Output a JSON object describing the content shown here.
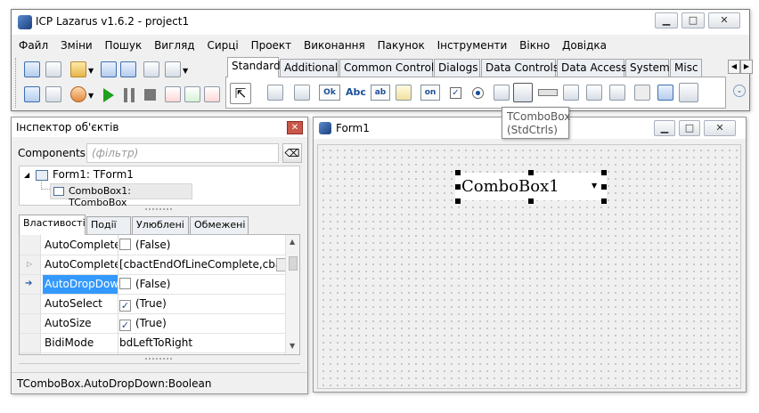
{
  "main": {
    "title": "ICP Lazarus v1.6.2 - project1",
    "menu": [
      "Файл",
      "Зміни",
      "Пошук",
      "Вигляд",
      "Сирці",
      "Проект",
      "Виконання",
      "Пакунок",
      "Інструменти",
      "Вікно",
      "Довідка"
    ],
    "palette_tabs": [
      "Standard",
      "Additional",
      "Common Controls",
      "Dialogs",
      "Data Controls",
      "Data Access",
      "System",
      "Misc"
    ],
    "active_tab": "Standard",
    "palette_labels": {
      "tbutton": "Ok",
      "tlabel": "Abc",
      "tedit": "ab",
      "ttoggle": "on"
    },
    "tooltip": {
      "line1": "TComboBox",
      "line2": "(StdCtrls)"
    }
  },
  "inspector": {
    "title": "Інспектор об'єктів",
    "components_label": "Components",
    "filter_placeholder": "(фільтр)",
    "tree": [
      {
        "label": "Form1: TForm1"
      },
      {
        "label": "ComboBox1: TComboBox"
      }
    ],
    "tabs": [
      "Властивості",
      "Події",
      "Улюблені",
      "Обмежені"
    ],
    "properties": [
      {
        "name": "AutoComplete",
        "value": "(False)",
        "checkbox": "unchecked"
      },
      {
        "name": "AutoCompleteText",
        "value": "[cbactEndOfLineComplete,cbactSe"
      },
      {
        "name": "AutoDropDown",
        "value": "(False)",
        "checkbox": "unchecked",
        "selected": true
      },
      {
        "name": "AutoSelect",
        "value": "(True)",
        "checkbox": "checked"
      },
      {
        "name": "AutoSize",
        "value": "(True)",
        "checkbox": "checked"
      },
      {
        "name": "BidiMode",
        "value": "bdLeftToRight"
      }
    ],
    "status": "TComboBox.AutoDropDown:Boolean"
  },
  "form": {
    "title": "Form1",
    "combobox_text": "ComboBox1"
  },
  "colors": {
    "selection": "#3399ff",
    "form_bg": "#f0f0f0",
    "tab_active": "#ffffff"
  }
}
